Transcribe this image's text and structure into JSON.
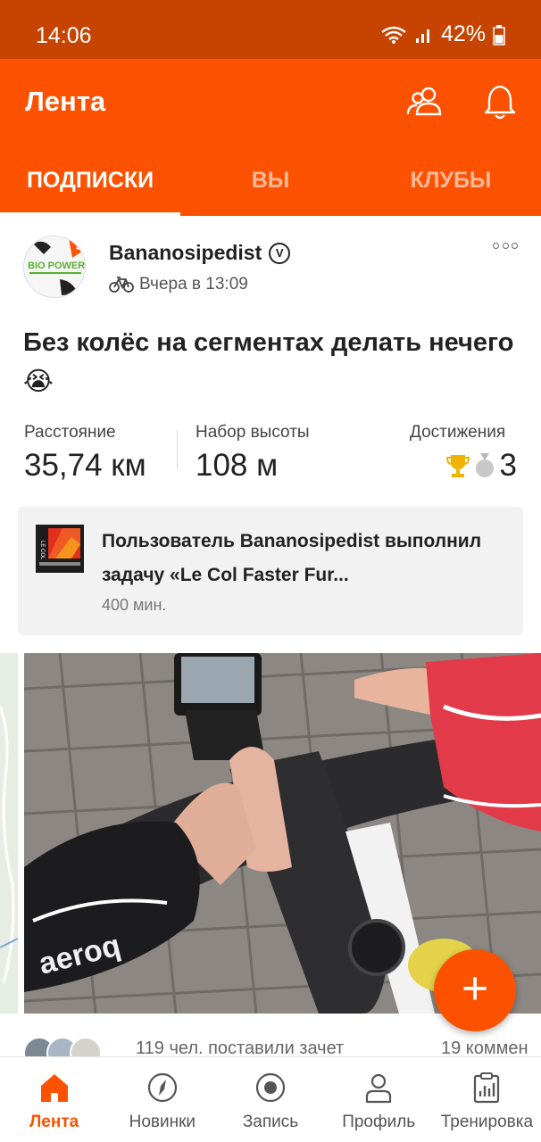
{
  "status_bar": {
    "time": "14:06",
    "battery": "42%"
  },
  "app_bar": {
    "title": "Лента"
  },
  "tabs": [
    {
      "label": "ПОДПИСКИ",
      "active": true
    },
    {
      "label": "ВЫ",
      "active": false
    },
    {
      "label": "КЛУБЫ",
      "active": false
    }
  ],
  "post": {
    "athlete": "Bananosipedist",
    "verified_mark": "V",
    "timestamp": "Вчера в 13:09",
    "activity_type_icon": "bike-icon",
    "title": "Без колёс на сегментах делать нечего😭",
    "stats": [
      {
        "label": "Расстояние",
        "value": "35,74 км"
      },
      {
        "label": "Набор высоты",
        "value": "108 м"
      },
      {
        "label": "Достижения",
        "value": "3"
      }
    ],
    "challenge": {
      "text": "Пользователь Bananosipedist выполнил задачу «Le Col Faster Fur...",
      "sub": "400 мин."
    },
    "kudos_text": "119 чел. поставили зачет",
    "comments_text": "19 коммен"
  },
  "fab_label": "+",
  "bottom_nav": [
    {
      "label": "Лента",
      "active": true
    },
    {
      "label": "Новинки",
      "active": false
    },
    {
      "label": "Запись",
      "active": false
    },
    {
      "label": "Профиль",
      "active": false
    },
    {
      "label": "Тренировка",
      "active": false
    }
  ],
  "colors": {
    "accent": "#fc5200",
    "status_bar": "#c74300",
    "trophy_gold": "#f0b400",
    "trophy_silver": "#b8b8b8"
  }
}
